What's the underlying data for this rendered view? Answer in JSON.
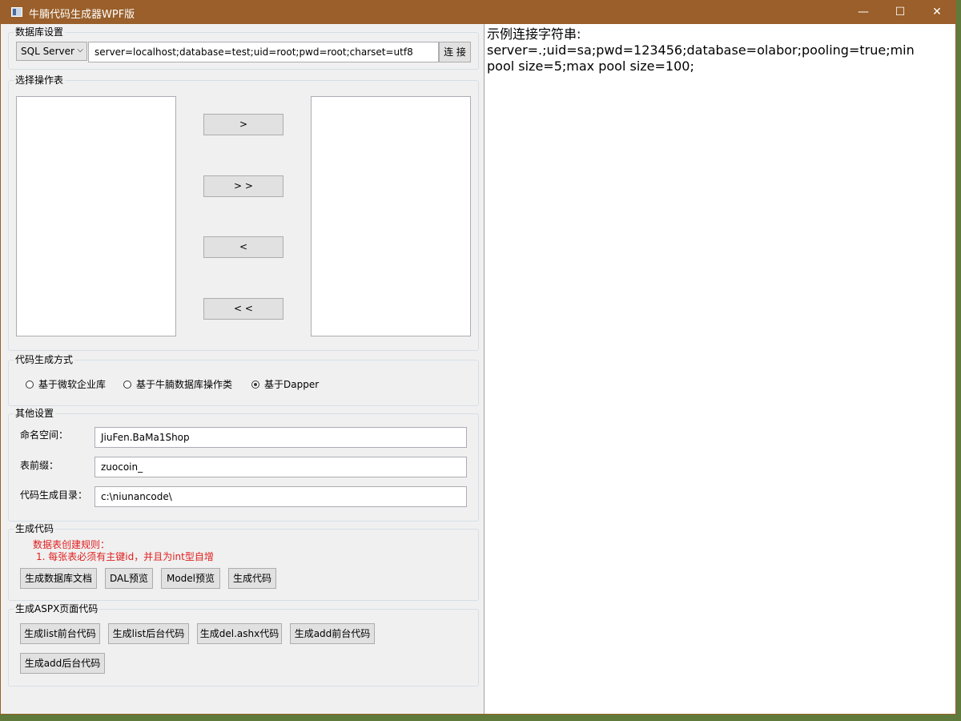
{
  "window": {
    "title": "牛腩代码生成器WPF版",
    "controls": {
      "minimize": "—",
      "maximize": "☐",
      "close": "✕"
    }
  },
  "db_settings": {
    "label": "数据库设置",
    "db_type_selected": "SQL Server",
    "connection_string": "server=localhost;database=test;uid=root;pwd=root;charset=utf8",
    "connect_label": "连 接"
  },
  "table_select": {
    "label": "选择操作表",
    "buttons": {
      "add_one": ">",
      "add_all": "> >",
      "remove_one": "<",
      "remove_all": "< <"
    }
  },
  "gen_mode": {
    "label": "代码生成方式",
    "options": [
      {
        "label": "基于微软企业库",
        "checked": false
      },
      {
        "label": "基于牛腩数据库操作类",
        "checked": false
      },
      {
        "label": "基于Dapper",
        "checked": true
      }
    ]
  },
  "other_settings": {
    "label": "其他设置",
    "namespace_label": "命名空间：",
    "namespace_value": "JiuFen.BaMa1Shop",
    "prefix_label": "表前缀：",
    "prefix_value": "zuocoin_",
    "output_dir_label": "代码生成目录：",
    "output_dir_value": "c:\\niunancode\\"
  },
  "gen_code": {
    "label": "生成代码",
    "rule_title": "数据表创建规则：",
    "rule_1": "1. 每张表必须有主键id，并且为int型自增",
    "buttons": {
      "db_doc": "生成数据库文档",
      "dal_preview": "DAL预览",
      "model_preview": "Model预览",
      "generate": "生成代码"
    }
  },
  "aspx": {
    "label": "生成ASPX页面代码",
    "buttons": {
      "list_front": "生成list前台代码",
      "list_back": "生成list后台代码",
      "del_ashx": "生成del.ashx代码",
      "add_front": "生成add前台代码",
      "add_back": "生成add后台代码"
    }
  },
  "sample": {
    "heading": "示例连接字符串:",
    "text": "server=.;uid=sa;pwd=123456;database=olabor;pooling=true;min pool size=5;max pool size=100;"
  }
}
